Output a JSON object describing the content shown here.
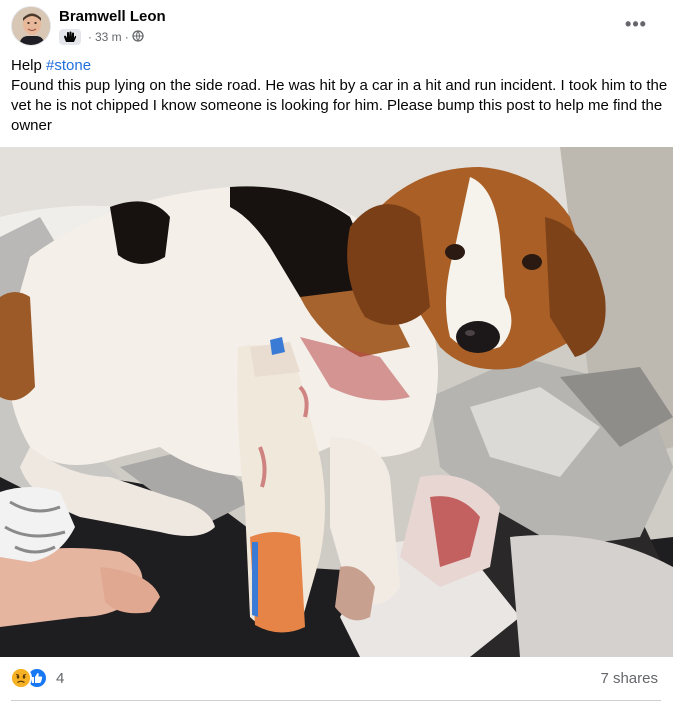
{
  "post": {
    "author": "Bramwell Leon",
    "time": "33 m",
    "separator": "·",
    "more_label": "•••",
    "text_prefix": "Help ",
    "hashtag": "#stone",
    "body": "Found this pup lying on the side road. He was hit by a car in a hit and run incident. I took him to the vet he is not chipped I know someone is looking for him. Please bump this post to help me find the owner",
    "icons": {
      "badge": "hand-wave-icon",
      "privacy": "globe-icon",
      "more": "more-options-icon",
      "reactions": [
        "sad-reaction-icon",
        "like-reaction-icon"
      ]
    }
  },
  "footer": {
    "reactions_count": "4",
    "shares": "7 shares"
  },
  "colors": {
    "link": "#216fdb",
    "secondary_text": "#65676b",
    "like_blue": "#1877f2",
    "sad_yellow": "#f7b125"
  }
}
